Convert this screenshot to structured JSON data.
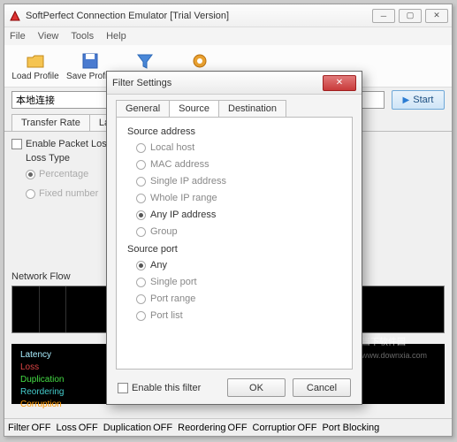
{
  "window": {
    "title": "SoftPerfect Connection Emulator [Trial Version]"
  },
  "menu": {
    "file": "File",
    "view": "View",
    "tools": "Tools",
    "help": "Help"
  },
  "toolbar": {
    "load": "Load Profile",
    "save": "Save Profile",
    "filter": "Setup Filter",
    "options": "Options"
  },
  "connection": {
    "value": "本地连接"
  },
  "start": "Start",
  "tabs": {
    "transfer": "Transfer Rate",
    "latency": "Latenc"
  },
  "packet_loss": {
    "enable": "Enable Packet Los",
    "loss_type": "Loss Type",
    "percentage": "Percentage",
    "fixed": "Fixed number"
  },
  "netflow_label": "Network Flow",
  "footer_labels": {
    "latency": "Latency",
    "loss": "Loss",
    "dup": "Duplication",
    "reorder": "Reordering",
    "corrupt": "Corruption"
  },
  "status": {
    "filter": "Filter",
    "loss": "Loss",
    "dup": "Duplication",
    "reorder": "Reordering",
    "corrupt": "Corruptior",
    "port": "Port Blocking",
    "off": "OFF"
  },
  "watermark": {
    "main": "当下软件园",
    "sub": "www.downxia.com"
  },
  "modal": {
    "title": "Filter Settings",
    "tabs": {
      "general": "General",
      "source": "Source",
      "destination": "Destination"
    },
    "source_address": "Source address",
    "addr": {
      "local": "Local host",
      "mac": "MAC address",
      "single_ip": "Single IP address",
      "whole_ip": "Whole IP range",
      "any_ip": "Any IP address",
      "group": "Group"
    },
    "source_port": "Source port",
    "port": {
      "any": "Any",
      "single": "Single port",
      "range": "Port range",
      "list": "Port list"
    },
    "enable": "Enable this filter",
    "ok": "OK",
    "cancel": "Cancel"
  }
}
